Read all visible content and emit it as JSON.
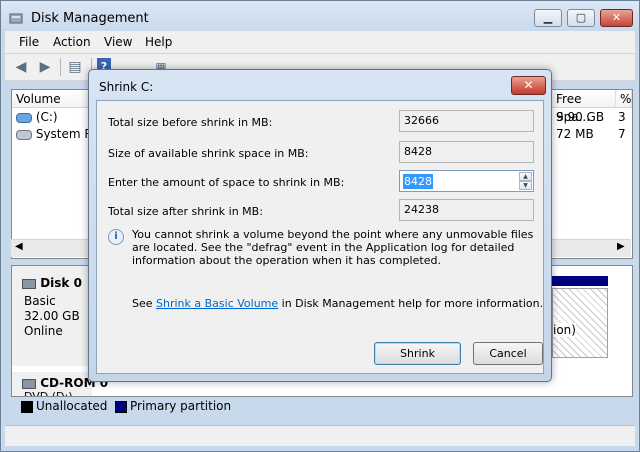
{
  "window": {
    "title": "Disk Management"
  },
  "menu": [
    "File",
    "Action",
    "View",
    "Help"
  ],
  "volumes": {
    "headers": {
      "volume": "Volume",
      "free_space": "Free Spa...",
      "pct": "%"
    },
    "rows": [
      {
        "name": "(C:)",
        "free": "9.90 GB",
        "pct": "3"
      },
      {
        "name": "System Re",
        "free": "72 MB",
        "pct": "7"
      }
    ]
  },
  "disk0": {
    "name": "Disk 0",
    "type": "Basic",
    "size": "32.00 GB",
    "status": "Online",
    "partition_fragment": "ion)"
  },
  "cdrom": {
    "name": "CD-ROM 0",
    "sub": "DVD (D:)"
  },
  "legend": {
    "unallocated": "Unallocated",
    "primary": "Primary partition",
    "unallocated_color": "#000000",
    "primary_color": "#000080"
  },
  "dialog": {
    "title": "Shrink C:",
    "close_glyph": "✕",
    "total_before_label": "Total size before shrink in MB:",
    "total_before_value": "32666",
    "available_label": "Size of available shrink space in MB:",
    "available_value": "8428",
    "amount_label": "Enter the amount of space to shrink in MB:",
    "amount_value": "8428",
    "total_after_label": "Total size after shrink in MB:",
    "total_after_value": "24238",
    "info": "You cannot shrink a volume beyond the point where any unmovable files are located. See the \"defrag\" event in the Application log for detailed information about the operation when it has completed.",
    "see_prefix": "See ",
    "see_link": "Shrink a Basic Volume",
    "see_suffix": " in Disk Management help for more information.",
    "shrink_button": "Shrink",
    "cancel_button": "Cancel"
  }
}
